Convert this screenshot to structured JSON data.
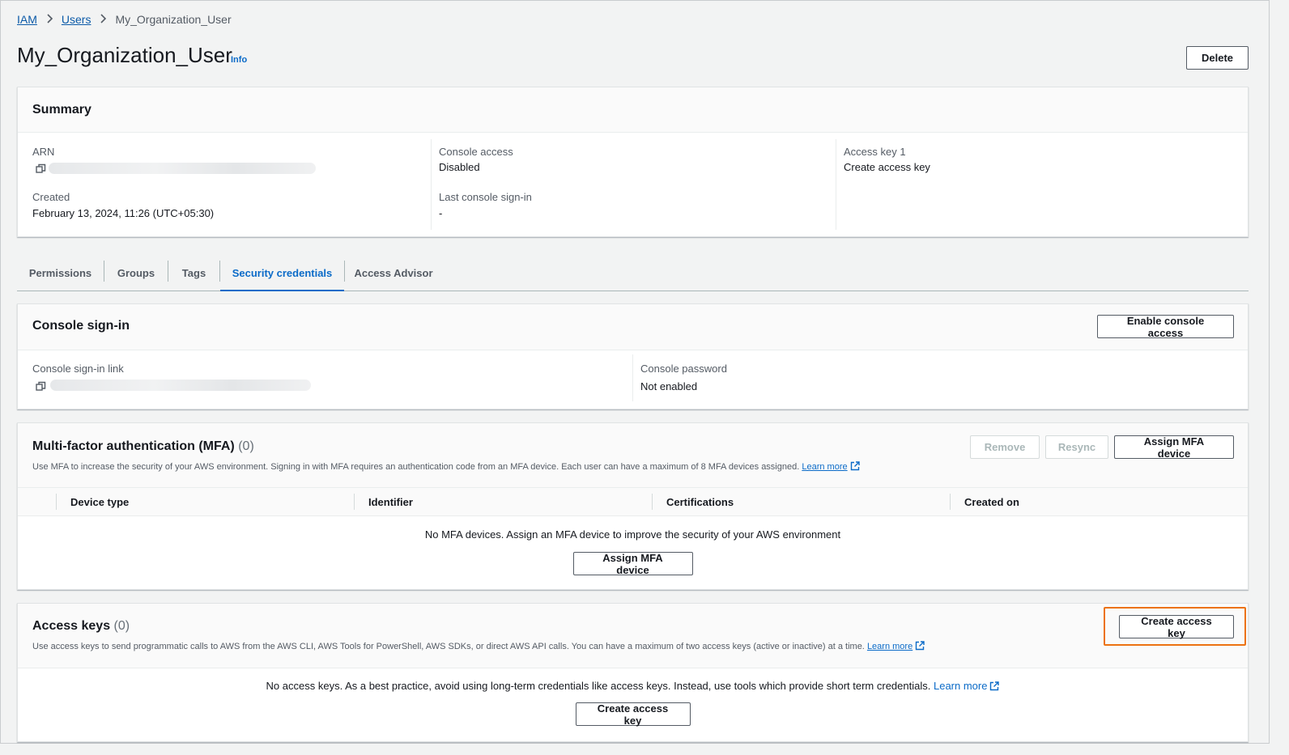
{
  "breadcrumb": {
    "items": [
      "IAM",
      "Users"
    ],
    "current": "My_Organization_User"
  },
  "header": {
    "title": "My_Organization_User",
    "info": "Info",
    "delete_label": "Delete"
  },
  "summary": {
    "title": "Summary",
    "arn_label": "ARN",
    "created_label": "Created",
    "created_value": "February 13, 2024, 11:26 (UTC+05:30)",
    "console_access_label": "Console access",
    "console_access_value": "Disabled",
    "last_signin_label": "Last console sign-in",
    "last_signin_value": "-",
    "access_key_label": "Access key 1",
    "access_key_link": "Create access key"
  },
  "tabs": [
    "Permissions",
    "Groups",
    "Tags",
    "Security credentials",
    "Access Advisor"
  ],
  "console_signin": {
    "title": "Console sign-in",
    "enable_button": "Enable console access",
    "link_label": "Console sign-in link",
    "password_label": "Console password",
    "password_value": "Not enabled"
  },
  "mfa": {
    "title": "Multi-factor authentication (MFA)",
    "count": "(0)",
    "description": "Use MFA to increase the security of your AWS environment. Signing in with MFA requires an authentication code from an MFA device. Each user can have a maximum of 8 MFA devices assigned.",
    "learn_more": "Learn more",
    "remove_button": "Remove",
    "resync_button": "Resync",
    "assign_button": "Assign MFA device",
    "columns": [
      "Device type",
      "Identifier",
      "Certifications",
      "Created on"
    ],
    "empty_text": "No MFA devices. Assign an MFA device to improve the security of your AWS environment",
    "empty_button": "Assign MFA device"
  },
  "access_keys": {
    "title": "Access keys",
    "count": "(0)",
    "description": "Use access keys to send programmatic calls to AWS from the AWS CLI, AWS Tools for PowerShell, AWS SDKs, or direct AWS API calls. You can have a maximum of two access keys (active or inactive) at a time.",
    "learn_more": "Learn more",
    "create_button": "Create access key",
    "empty_text": "No access keys. As a best practice, avoid using long-term credentials like access keys. Instead, use tools which provide short term credentials.",
    "empty_learn_more": "Learn more",
    "empty_button": "Create access key"
  },
  "colors": {
    "link": "#0b6bc8",
    "highlight": "#ec7211",
    "text": "#16191f",
    "muted": "#545b64"
  }
}
